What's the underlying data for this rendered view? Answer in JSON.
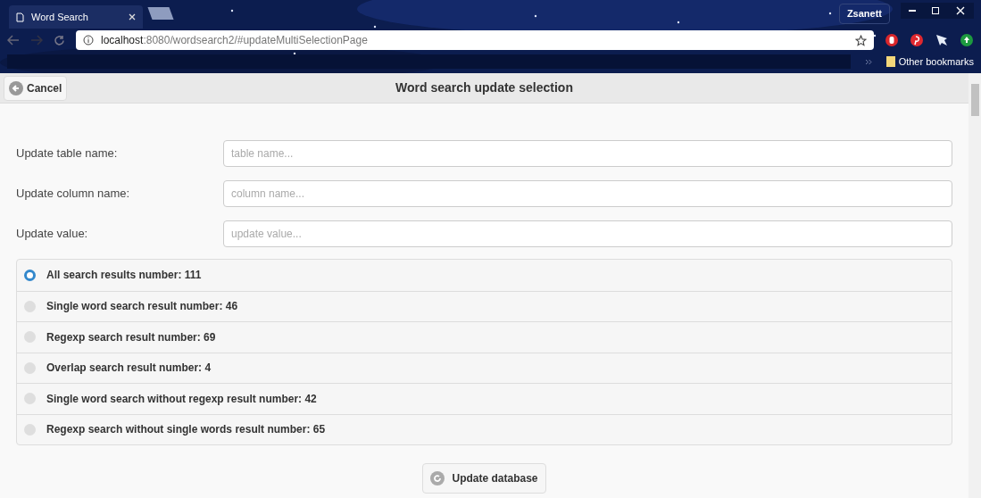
{
  "browser": {
    "tab_title": "Word Search",
    "profile": "Zsanett",
    "url_host": "localhost",
    "url_path": ":8080/wordsearch2/#updateMultiSelectionPage",
    "bookmarks_folder": "Other bookmarks"
  },
  "header": {
    "back_button": "Cancel",
    "title": "Word search update selection"
  },
  "fields": [
    {
      "label": "Update table name:",
      "placeholder": "table name..."
    },
    {
      "label": "Update column name:",
      "placeholder": "column name..."
    },
    {
      "label": "Update value:",
      "placeholder": "update value..."
    }
  ],
  "options": [
    {
      "label": "All search results number: 111",
      "selected": true
    },
    {
      "label": "Single word search result number: 46",
      "selected": false
    },
    {
      "label": "Regexp search result number: 69",
      "selected": false
    },
    {
      "label": "Overlap search result number: 4",
      "selected": false
    },
    {
      "label": "Single word search without regexp result number: 42",
      "selected": false
    },
    {
      "label": "Regexp search without single words result number: 65",
      "selected": false
    }
  ],
  "submit_button": "Update database"
}
